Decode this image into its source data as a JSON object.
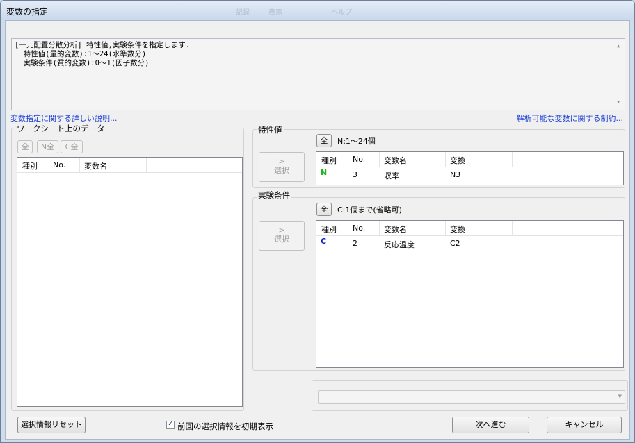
{
  "window": {
    "title": "変数の指定"
  },
  "background_ghost": [
    "記録",
    "表示",
    "ヘルプ"
  ],
  "description": {
    "lines": [
      "[一元配置分散分析] 特性値,実験条件を指定します.",
      "  特性値(量的変数):1～24(水準数分)",
      "  実験条件(質的変数):0～1(因子数分)"
    ]
  },
  "links": {
    "help": "変数指定に関する詳しい説明...",
    "limits": "解析可能な変数に関する制約..."
  },
  "worksheet": {
    "label": "ワークシート上のデータ",
    "buttons": {
      "all": "全",
      "n_all": "N全",
      "c_all": "C全"
    },
    "columns": [
      "種別",
      "No.",
      "変数名"
    ]
  },
  "characteristic": {
    "label": "特性値",
    "all_button": "全",
    "summary": "N:1～24個",
    "select_button": {
      "arrow": ">",
      "label": "選択"
    },
    "columns": [
      "種別",
      "No.",
      "変数名",
      "変換"
    ],
    "rows": [
      {
        "kind": "N",
        "no": "3",
        "name": "収率",
        "transform": "N3"
      }
    ]
  },
  "condition": {
    "label": "実験条件",
    "all_button": "全",
    "summary": "C:1個まで(省略可)",
    "select_button": {
      "arrow": ">",
      "label": "選択"
    },
    "columns": [
      "種別",
      "No.",
      "変数名",
      "変換"
    ],
    "rows": [
      {
        "kind": "C",
        "no": "2",
        "name": "反応温度",
        "transform": "C2"
      }
    ]
  },
  "footer": {
    "reset_button": "選択情報リセット",
    "checkbox_label": "前回の選択情報を初期表示",
    "checkbox_checked": true,
    "next_button": "次へ進む",
    "cancel_button": "キャンセル"
  },
  "colors": {
    "kind_n": "#1fb51f",
    "kind_c": "#0a18c9",
    "link": "#1c3fd6"
  }
}
